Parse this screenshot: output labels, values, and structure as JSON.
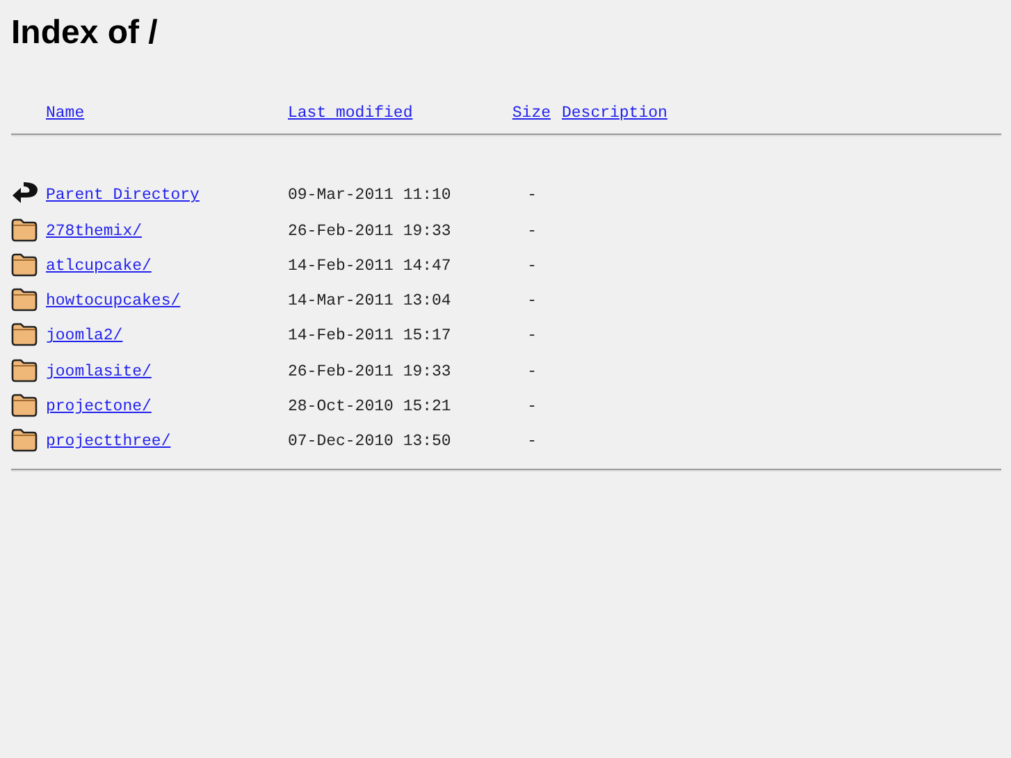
{
  "title": "Index of /",
  "columns": [
    "Name",
    "Last modified",
    "Size",
    "Description"
  ],
  "rows": [
    {
      "kind": "parent",
      "name": "Parent Directory",
      "modified": "09-Mar-2011 11:10",
      "size": "-"
    },
    {
      "kind": "folder",
      "name": "278themix/",
      "modified": "26-Feb-2011 19:33",
      "size": "-"
    },
    {
      "kind": "folder",
      "name": "atlcupcake/",
      "modified": "14-Feb-2011 14:47",
      "size": "-"
    },
    {
      "kind": "folder",
      "name": "howtocupcakes/",
      "modified": "14-Mar-2011 13:04",
      "size": "-"
    },
    {
      "kind": "folder",
      "name": "joomla2/",
      "modified": "14-Feb-2011 15:17",
      "size": "-"
    },
    {
      "kind": "folder",
      "name": "joomlasite/",
      "modified": "26-Feb-2011 19:33",
      "size": "-"
    },
    {
      "kind": "folder",
      "name": "projectone/",
      "modified": "28-Oct-2010 15:21",
      "size": "-"
    },
    {
      "kind": "folder",
      "name": "projectthree/",
      "modified": "07-Dec-2010 13:50",
      "size": "-"
    }
  ]
}
